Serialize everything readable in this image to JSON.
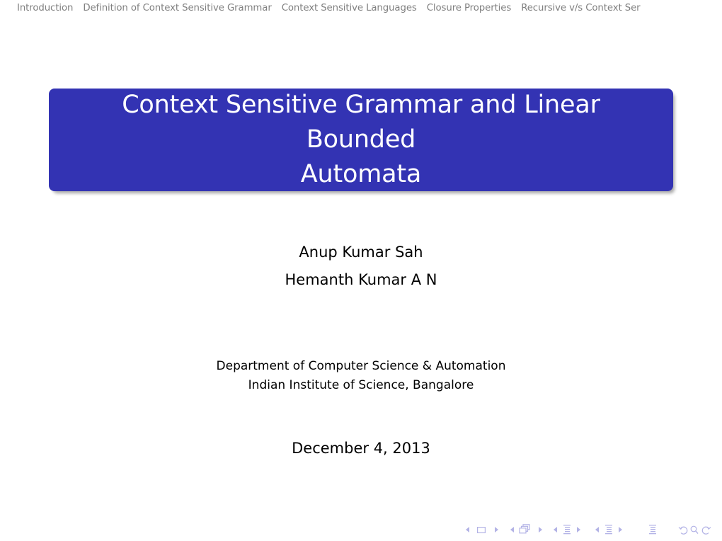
{
  "headline": {
    "sections": [
      "Introduction",
      "Definition of Context Sensitive Grammar",
      "Context Sensitive Languages",
      "Closure Properties",
      "Recursive v/s Context Ser"
    ]
  },
  "title_slide": {
    "title_line1": "Context Sensitive Grammar and Linear Bounded",
    "title_line2": "Automata",
    "authors": [
      "Anup Kumar Sah",
      "Hemanth Kumar A N"
    ],
    "institute": [
      "Department of Computer Science & Automation",
      "Indian Institute of Science, Bangalore"
    ],
    "date": "December 4, 2013"
  },
  "navigation_symbols": [
    {
      "name": "prev-slide-icon"
    },
    {
      "name": "slide-icon"
    },
    {
      "name": "next-slide-icon"
    },
    {
      "name": "prev-frame-icon"
    },
    {
      "name": "frame-icon"
    },
    {
      "name": "next-frame-icon"
    },
    {
      "name": "prev-subsection-icon"
    },
    {
      "name": "subsection-icon"
    },
    {
      "name": "next-subsection-icon"
    },
    {
      "name": "prev-section-icon"
    },
    {
      "name": "section-icon"
    },
    {
      "name": "next-section-icon"
    },
    {
      "name": "document-icon"
    },
    {
      "name": "back-icon"
    },
    {
      "name": "search-icon"
    },
    {
      "name": "forward-icon"
    }
  ],
  "colors": {
    "title_block_bg": "#3333b3",
    "title_text": "#ffffff",
    "headline_text": "#808080",
    "nav_symbol": "#b3b3e6"
  }
}
